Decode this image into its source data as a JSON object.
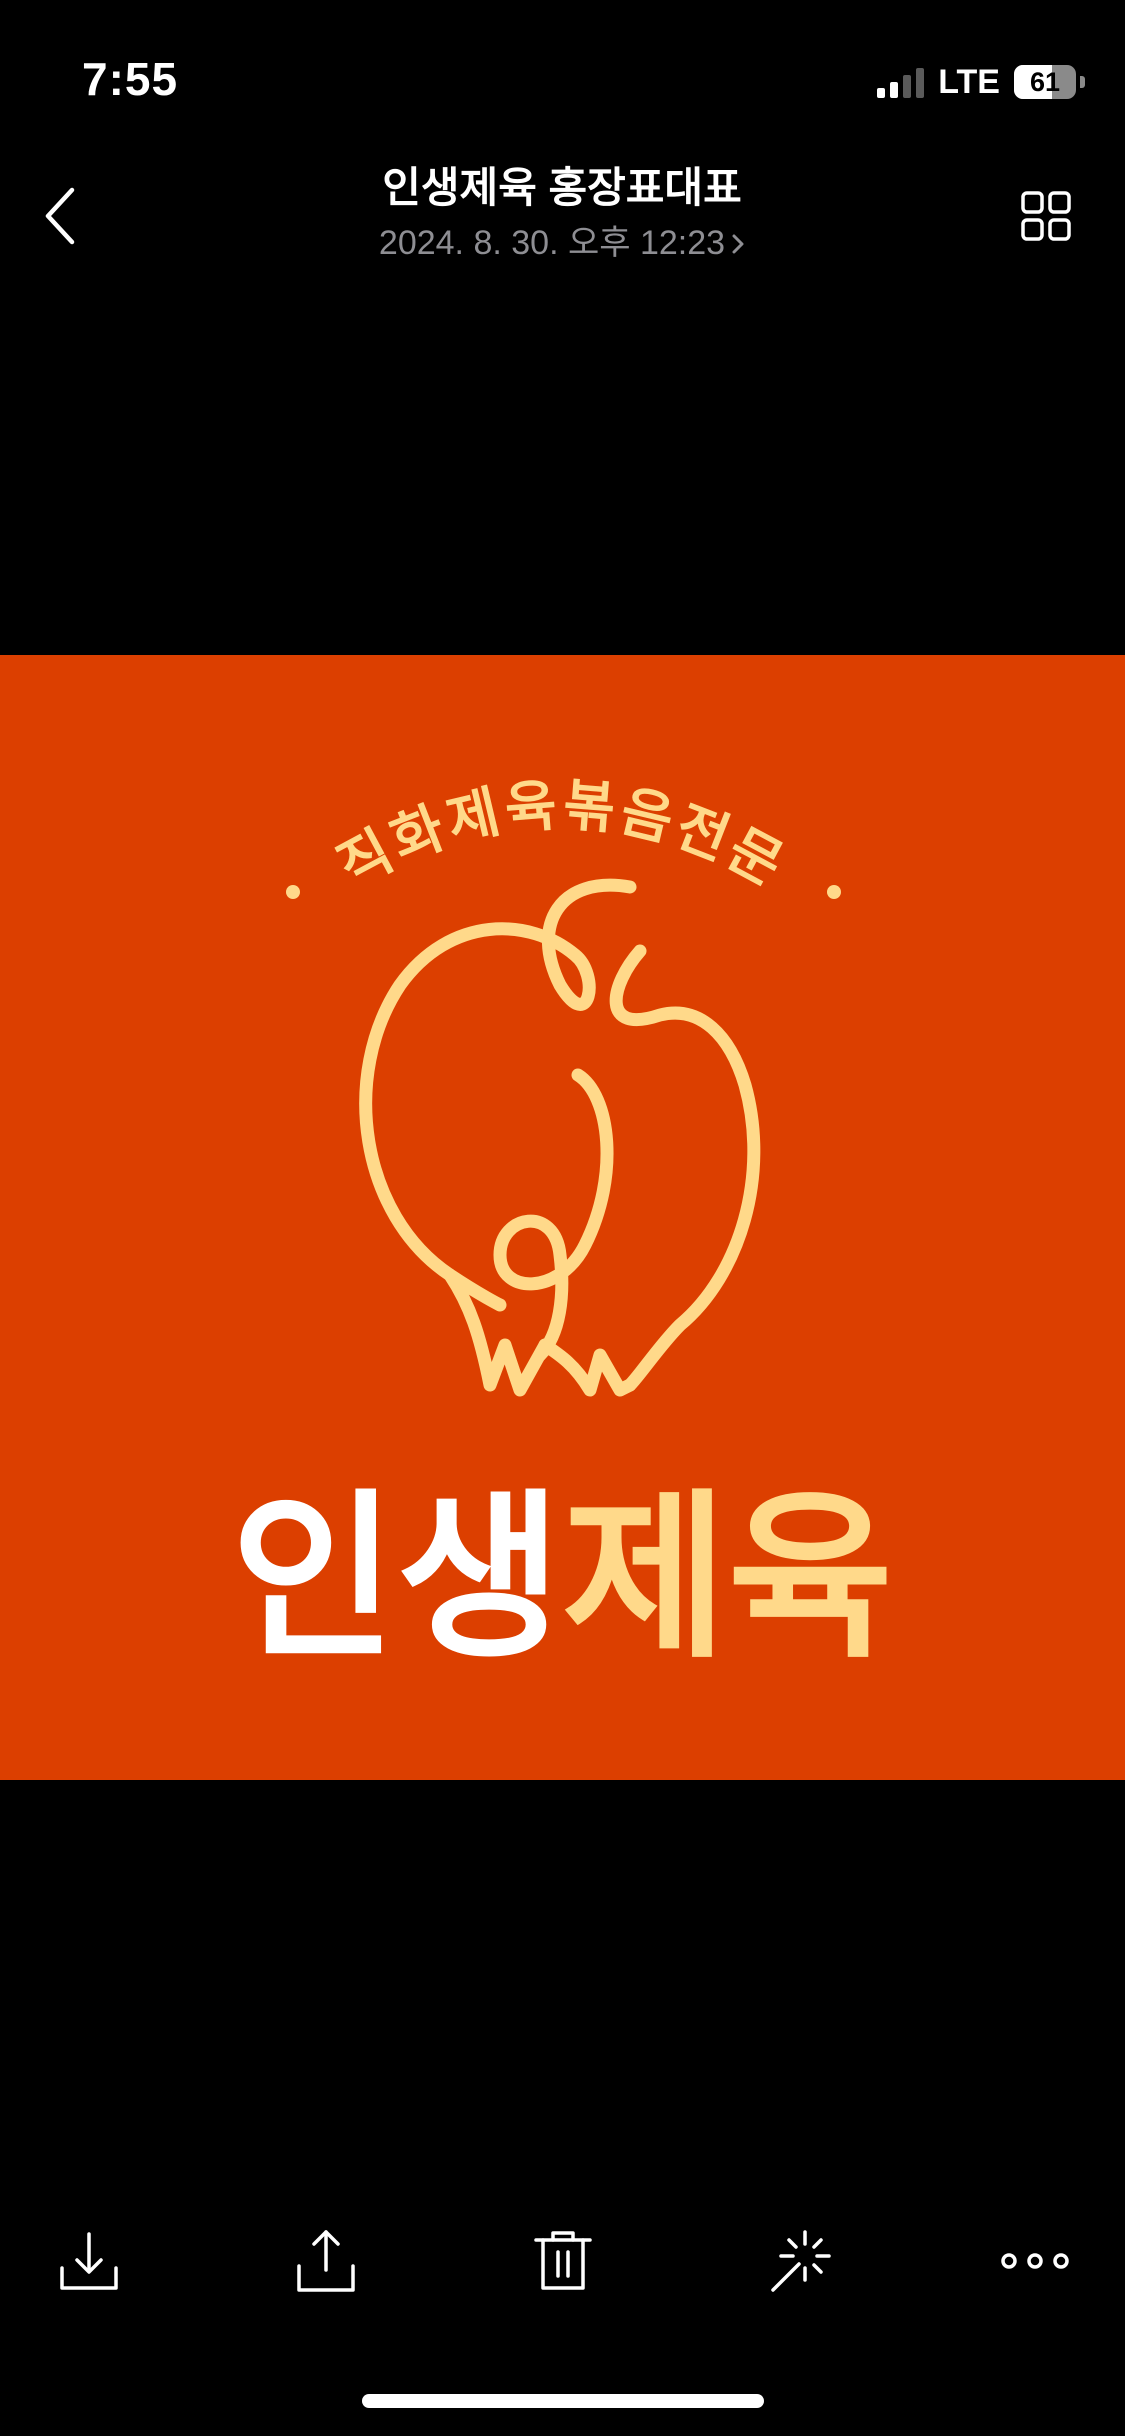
{
  "status_bar": {
    "time": "7:55",
    "network": "LTE",
    "battery_level": "61",
    "battery_fraction": 0.61,
    "signal_bars_active": 2,
    "signal_bars_total": 4
  },
  "header": {
    "back_icon": "chevron-left-icon",
    "title": "인생제육 홍장표대표",
    "subtitle": "2024. 8. 30. 오후 12:23",
    "grid_icon": "grid-icon"
  },
  "photo": {
    "tagline": "직화제육볶음전문",
    "brand_white": "인생",
    "brand_yellow": "제육",
    "colors": {
      "background": "#dc3f00",
      "accent": "#ffd98a",
      "white": "#ffffff"
    }
  },
  "toolbar": {
    "items": [
      {
        "name": "download-icon"
      },
      {
        "name": "share-icon"
      },
      {
        "name": "trash-icon"
      },
      {
        "name": "magic-wand-icon"
      },
      {
        "name": "more-icon"
      }
    ]
  }
}
